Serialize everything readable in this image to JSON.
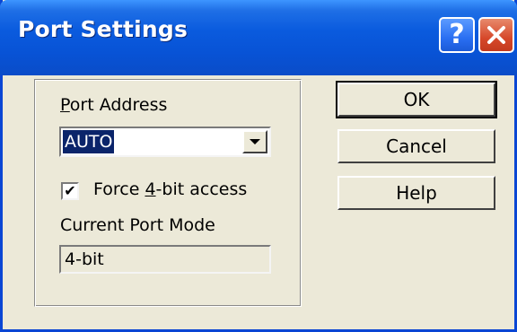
{
  "window": {
    "title": "Port Settings"
  },
  "titlebar": {
    "help_glyph": "?",
    "icons": {
      "help": "help-question-icon",
      "close": "close-x-icon"
    },
    "colors": {
      "titlebar": "#0853d6",
      "close": "#d6482a",
      "help": "#2a6ff2"
    }
  },
  "group": {
    "port_label_prefix": "",
    "port_label_mnemonic": "P",
    "port_label_rest": "ort Address",
    "port_value": "AUTO",
    "checkbox_prefix": "Force ",
    "checkbox_mnemonic": "4",
    "checkbox_rest": "-bit access",
    "checkbox_checked": true,
    "mode_label": "Current Port Mode",
    "mode_value": "4-bit"
  },
  "buttons": {
    "ok": "OK",
    "cancel": "Cancel",
    "help": "Help"
  }
}
